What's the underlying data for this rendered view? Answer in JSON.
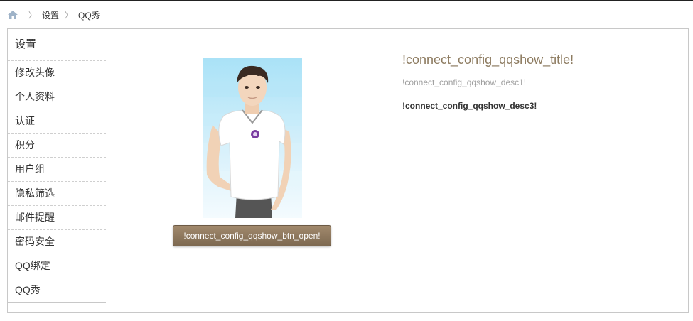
{
  "breadcrumb": {
    "home_icon": "home-icon",
    "items": [
      "设置",
      "QQ秀"
    ]
  },
  "sidebar": {
    "title": "设置",
    "items": [
      {
        "label": "修改头像"
      },
      {
        "label": "个人资料"
      },
      {
        "label": "认证"
      },
      {
        "label": "积分"
      },
      {
        "label": "用户组"
      },
      {
        "label": "隐私筛选"
      },
      {
        "label": "邮件提醒"
      },
      {
        "label": "密码安全"
      },
      {
        "label": "QQ绑定"
      },
      {
        "label": "QQ秀"
      }
    ]
  },
  "qqshow": {
    "title": "!connect_config_qqshow_title!",
    "desc1": "!connect_config_qqshow_desc1!",
    "desc3": "!connect_config_qqshow_desc3!",
    "open_button": "!connect_config_qqshow_btn_open!"
  },
  "colors": {
    "accent_title": "#8d7b60",
    "button": "#8a7459",
    "border": "#c8c8c8"
  }
}
